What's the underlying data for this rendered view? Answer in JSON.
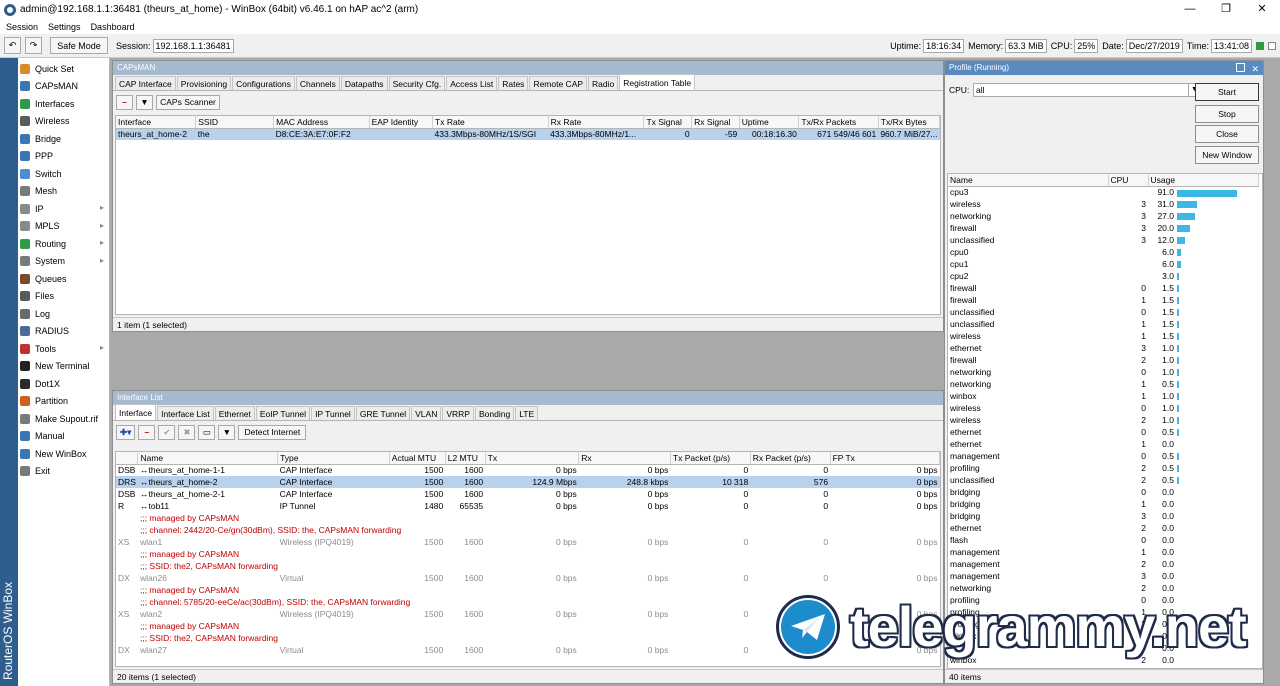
{
  "window": {
    "title": "admin@192.168.1.1:36481 (theurs_at_home) - WinBox (64bit) v6.46.1 on hAP ac^2 (arm)",
    "minimize": "—",
    "maximize": "❐",
    "close": "✕"
  },
  "menu": [
    "Session",
    "Settings",
    "Dashboard"
  ],
  "toolbar": {
    "undo": "↶",
    "redo": "↷",
    "safe_mode": "Safe Mode",
    "session_label": "Session:",
    "session_value": "192.168.1.1:36481",
    "uptime_label": "Uptime:",
    "uptime_value": "18:16:34",
    "memory_label": "Memory:",
    "memory_value": "63.3 MiB",
    "cpu_label": "CPU:",
    "cpu_value": "25%",
    "date_label": "Date:",
    "date_value": "Dec/27/2019",
    "time_label": "Time:",
    "time_value": "13:41:08"
  },
  "brand": "RouterOS WinBox",
  "sidebar": [
    {
      "label": "Quick Set",
      "color": "#d98c2b",
      "arrow": false
    },
    {
      "label": "CAPsMAN",
      "color": "#3a76b4",
      "arrow": false
    },
    {
      "label": "Interfaces",
      "color": "#2f9a4a",
      "arrow": false
    },
    {
      "label": "Wireless",
      "color": "#5b5b5b",
      "arrow": false
    },
    {
      "label": "Bridge",
      "color": "#3a76b4",
      "arrow": false
    },
    {
      "label": "PPP",
      "color": "#3a76b4",
      "arrow": false
    },
    {
      "label": "Switch",
      "color": "#4a8fd0",
      "arrow": false
    },
    {
      "label": "Mesh",
      "color": "#7a7a7a",
      "arrow": false
    },
    {
      "label": "IP",
      "color": "#8a8a8a",
      "arrow": true
    },
    {
      "label": "MPLS",
      "color": "#8a8a8a",
      "arrow": true
    },
    {
      "label": "Routing",
      "color": "#2f9a4a",
      "arrow": true
    },
    {
      "label": "System",
      "color": "#7a7a7a",
      "arrow": true
    },
    {
      "label": "Queues",
      "color": "#7a4a2a",
      "arrow": false
    },
    {
      "label": "Files",
      "color": "#5a5a5a",
      "arrow": false
    },
    {
      "label": "Log",
      "color": "#6a6a6a",
      "arrow": false
    },
    {
      "label": "RADIUS",
      "color": "#4a6a9a",
      "arrow": false
    },
    {
      "label": "Tools",
      "color": "#c03030",
      "arrow": true
    },
    {
      "label": "New Terminal",
      "color": "#222222",
      "arrow": false
    },
    {
      "label": "Dot1X",
      "color": "#2a2a2a",
      "arrow": false
    },
    {
      "label": "Partition",
      "color": "#d06020",
      "arrow": false
    },
    {
      "label": "Make Supout.rif",
      "color": "#7a7a7a",
      "arrow": false
    },
    {
      "label": "Manual",
      "color": "#3a76b4",
      "arrow": false
    },
    {
      "label": "New WinBox",
      "color": "#3a76b4",
      "arrow": false
    },
    {
      "label": "Exit",
      "color": "#7a7a7a",
      "arrow": false
    }
  ],
  "capsman": {
    "title": "CAPsMAN",
    "tabs": [
      "CAP Interface",
      "Provisioning",
      "Configurations",
      "Channels",
      "Datapaths",
      "Security Cfg.",
      "Access List",
      "Rates",
      "Remote CAP",
      "Radio",
      "Registration Table"
    ],
    "active_tab": 10,
    "remove_btn": "–",
    "filter_btn": "▼",
    "scanner_btn": "CAPs Scanner",
    "columns": [
      "Interface",
      "SSID",
      "MAC Address",
      "EAP Identity",
      "Tx Rate",
      "Rx Rate",
      "Tx Signal",
      "Rx Signal",
      "Uptime",
      "Tx/Rx Packets",
      "Tx/Rx Bytes"
    ],
    "rows": [
      [
        "theurs_at_home-2",
        "the",
        "D8:CE:3A:E7:0F:F2",
        "",
        "433.3Mbps-80MHz/1S/SGI",
        "433.3Mbps-80MHz/1...",
        "0",
        "-59",
        "00:18:16.30",
        "671 549/46 601",
        "960.7 MiB/27..."
      ]
    ],
    "status": "1 item (1 selected)"
  },
  "iflist": {
    "title": "Interface List",
    "tabs": [
      "Interface",
      "Interface List",
      "Ethernet",
      "EoIP Tunnel",
      "IP Tunnel",
      "GRE Tunnel",
      "VLAN",
      "VRRP",
      "Bonding",
      "LTE"
    ],
    "active_tab": 0,
    "add_btn": "✚▾",
    "remove_btn": "–",
    "enable_btn": "✔",
    "disable_btn": "✖",
    "comment_btn": "▭",
    "filter_btn": "▼",
    "detect_btn": "Detect Internet",
    "columns": [
      "",
      "Name",
      "Type",
      "Actual MTU",
      "L2 MTU",
      "Tx",
      "Rx",
      "Tx Packet (p/s)",
      "Rx Packet (p/s)",
      "FP Tx"
    ],
    "rows": [
      {
        "kind": "normal",
        "cells": [
          "DSB",
          "↔theurs_at_home-1-1",
          "CAP Interface",
          "1500",
          "1600",
          "0 bps",
          "0 bps",
          "0",
          "0",
          "0 bps"
        ]
      },
      {
        "kind": "sel",
        "cells": [
          "DRS",
          "↔theurs_at_home-2",
          "CAP Interface",
          "1500",
          "1600",
          "124.9 Mbps",
          "248.8 kbps",
          "10 318",
          "576",
          "0 bps"
        ]
      },
      {
        "kind": "normal",
        "cells": [
          "DSB",
          "↔theurs_at_home-2-1",
          "CAP Interface",
          "1500",
          "1600",
          "0 bps",
          "0 bps",
          "0",
          "0",
          "0 bps"
        ]
      },
      {
        "kind": "normal",
        "cells": [
          "R",
          "↔tob11",
          "IP Tunnel",
          "1480",
          "65535",
          "0 bps",
          "0 bps",
          "0",
          "0",
          "0 bps"
        ]
      },
      {
        "kind": "red",
        "text": ";;; managed by CAPsMAN"
      },
      {
        "kind": "red",
        "text": ";;; channel: 2442/20-Ce/gn(30dBm), SSID: the, CAPsMAN forwarding"
      },
      {
        "kind": "dis",
        "cells": [
          "XS",
          "wlan1",
          "Wireless (IPQ4019)",
          "1500",
          "1600",
          "0 bps",
          "0 bps",
          "0",
          "0",
          "0 bps"
        ]
      },
      {
        "kind": "red",
        "text": ";;; managed by CAPsMAN"
      },
      {
        "kind": "red",
        "text": ";;; SSID: the2, CAPsMAN forwarding"
      },
      {
        "kind": "dis",
        "cells": [
          "DX",
          "wlan26",
          "Virtual",
          "1500",
          "1600",
          "0 bps",
          "0 bps",
          "0",
          "0",
          "0 bps"
        ]
      },
      {
        "kind": "red",
        "text": ";;; managed by CAPsMAN"
      },
      {
        "kind": "red",
        "text": ";;; channel: 5785/20-eeCe/ac(30dBm), SSID: the, CAPsMAN forwarding"
      },
      {
        "kind": "dis",
        "cells": [
          "XS",
          "wlan2",
          "Wireless (IPQ4019)",
          "1500",
          "1600",
          "0 bps",
          "0 bps",
          "0",
          "0",
          "0 bps"
        ]
      },
      {
        "kind": "red",
        "text": ";;; managed by CAPsMAN"
      },
      {
        "kind": "red",
        "text": ";;; SSID: the2, CAPsMAN forwarding"
      },
      {
        "kind": "dis",
        "cells": [
          "DX",
          "wlan27",
          "Virtual",
          "1500",
          "1600",
          "0 bps",
          "0 bps",
          "0",
          "0",
          "0 bps"
        ]
      }
    ],
    "status": "20 items (1 selected)"
  },
  "profile": {
    "title": "Profile (Running)",
    "cpu_label": "CPU:",
    "cpu_value": "all",
    "buttons": [
      "Start",
      "Stop",
      "Close",
      "New Window"
    ],
    "columns": [
      "Name",
      "CPU",
      "Usage"
    ],
    "rows": [
      [
        "cpu3",
        "",
        91.0
      ],
      [
        "wireless",
        "3",
        31.0
      ],
      [
        "networking",
        "3",
        27.0
      ],
      [
        "firewall",
        "3",
        20.0
      ],
      [
        "unclassified",
        "3",
        12.0
      ],
      [
        "cpu0",
        "",
        6.0
      ],
      [
        "cpu1",
        "",
        6.0
      ],
      [
        "cpu2",
        "",
        3.0
      ],
      [
        "firewall",
        "0",
        1.5
      ],
      [
        "firewall",
        "1",
        1.5
      ],
      [
        "unclassified",
        "0",
        1.5
      ],
      [
        "unclassified",
        "1",
        1.5
      ],
      [
        "wireless",
        "1",
        1.5
      ],
      [
        "ethernet",
        "3",
        1.0
      ],
      [
        "firewall",
        "2",
        1.0
      ],
      [
        "networking",
        "0",
        1.0
      ],
      [
        "networking",
        "1",
        0.5
      ],
      [
        "winbox",
        "1",
        1.0
      ],
      [
        "wireless",
        "0",
        1.0
      ],
      [
        "wireless",
        "2",
        1.0
      ],
      [
        "ethernet",
        "0",
        0.5
      ],
      [
        "ethernet",
        "1",
        0.0
      ],
      [
        "management",
        "0",
        0.5
      ],
      [
        "profiling",
        "2",
        0.5
      ],
      [
        "unclassified",
        "2",
        0.5
      ],
      [
        "bridging",
        "0",
        0.0
      ],
      [
        "bridging",
        "1",
        0.0
      ],
      [
        "bridging",
        "3",
        0.0
      ],
      [
        "ethernet",
        "2",
        0.0
      ],
      [
        "flash",
        "0",
        0.0
      ],
      [
        "management",
        "1",
        0.0
      ],
      [
        "management",
        "2",
        0.0
      ],
      [
        "management",
        "3",
        0.0
      ],
      [
        "networking",
        "2",
        0.0
      ],
      [
        "profiling",
        "0",
        0.0
      ],
      [
        "profiling",
        "1",
        0.0
      ],
      [
        "profiling",
        "3",
        0.0
      ],
      [
        "winbox",
        "0",
        0.0
      ],
      [
        "",
        "",
        0.0
      ],
      [
        "winbox",
        "2",
        0.0
      ]
    ],
    "status": "40 items"
  },
  "watermark": "telegrammy.net"
}
